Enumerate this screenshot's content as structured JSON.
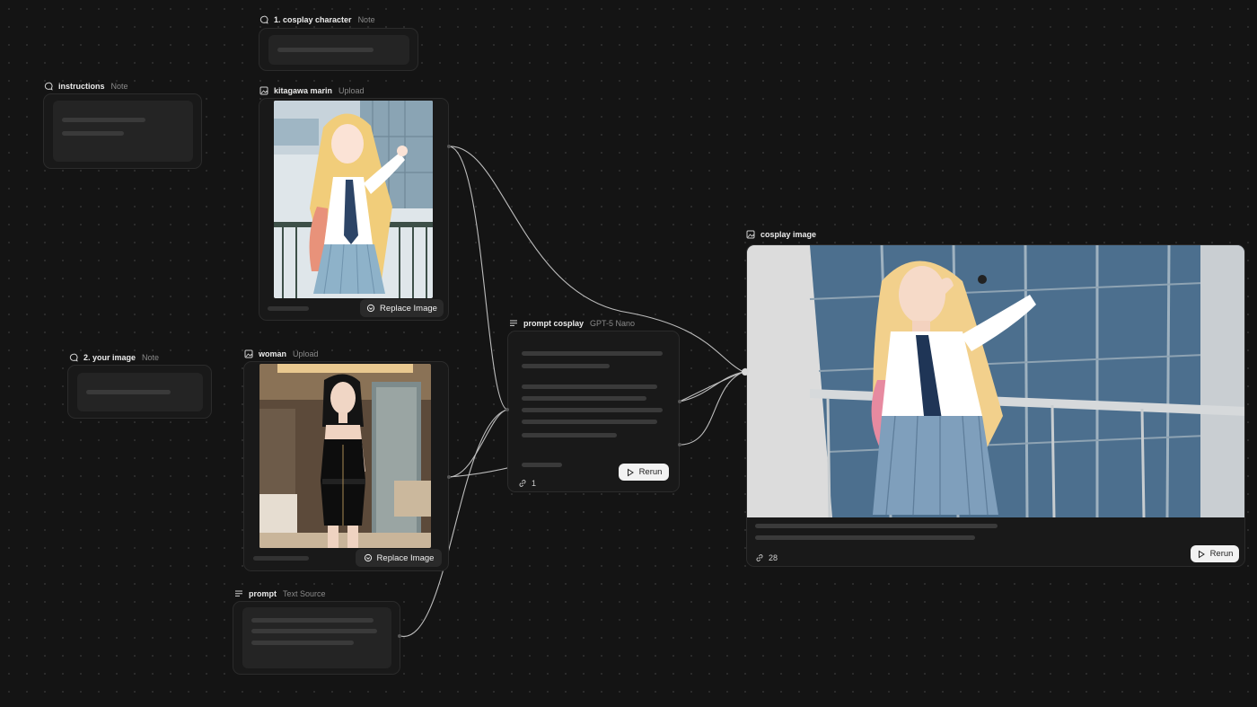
{
  "nodes": {
    "cosplay_character": {
      "title": "1. cosplay character",
      "type": "Note"
    },
    "instructions": {
      "title": "instructions",
      "type": "Note"
    },
    "kitagawa_marin": {
      "title": "kitagawa marin",
      "type": "Upload",
      "button": "Replace Image"
    },
    "your_image": {
      "title": "2. your image",
      "type": "Note"
    },
    "woman": {
      "title": "woman",
      "type": "Upload",
      "button": "Replace Image"
    },
    "prompt": {
      "title": "prompt",
      "type": "Text Source"
    },
    "prompt_cosplay": {
      "title": "prompt cosplay",
      "type": "GPT-5 Nano",
      "button": "Rerun",
      "count": "1"
    },
    "cosplay_image": {
      "title": "cosplay image",
      "type": "",
      "button": "Rerun",
      "count": "28"
    }
  },
  "icons": {
    "note": "speech-bubble-icon",
    "upload": "image-icon",
    "text": "text-lines-icon",
    "rerun": "play-icon",
    "count": "link-icon",
    "replace": "refresh-icon"
  },
  "colors": {
    "canvas": "#141414",
    "node": "#191919",
    "node_border": "#2b2b2b",
    "edge": "#bdbdbd",
    "button_light": "#f2f2f2"
  }
}
